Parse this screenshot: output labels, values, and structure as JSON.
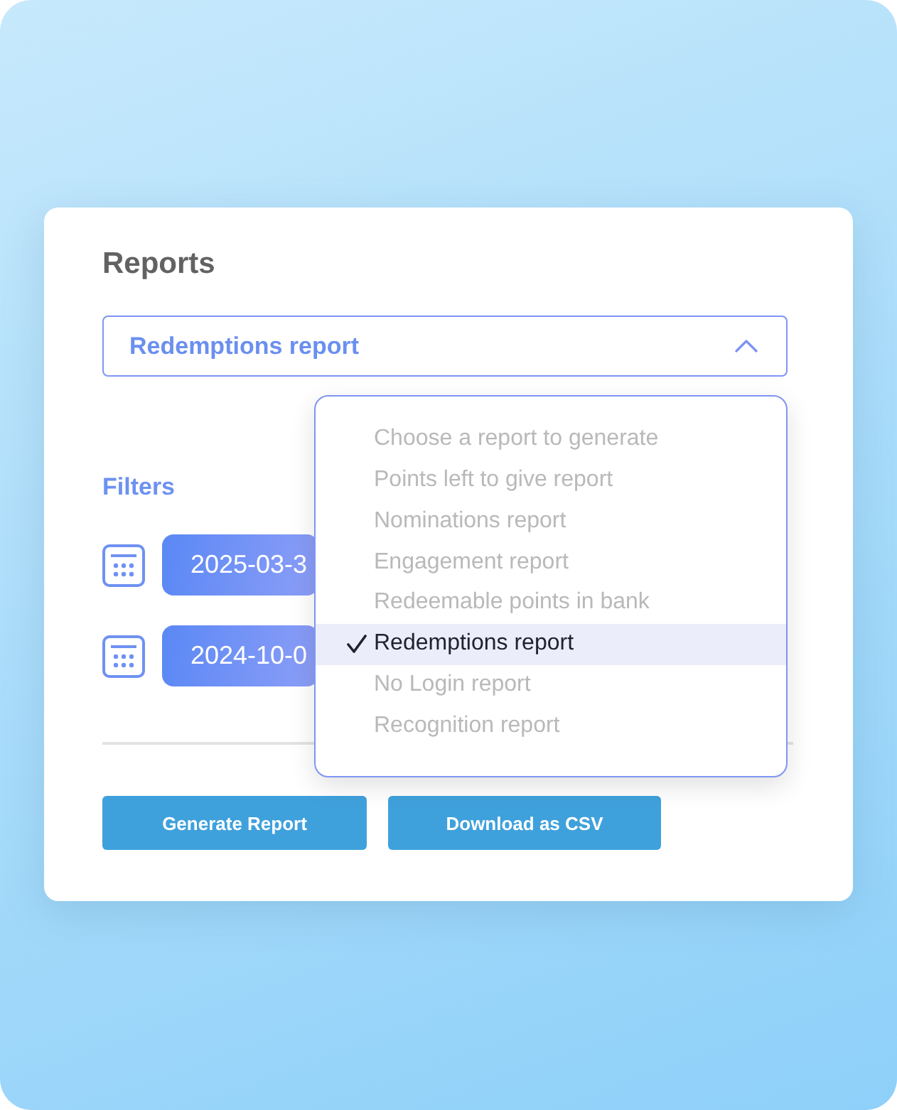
{
  "title": "Reports",
  "report_select": {
    "value": "Redemptions report",
    "expanded": true,
    "options": [
      {
        "label": "Choose a report to generate",
        "selected": false
      },
      {
        "label": "Points left to give report",
        "selected": false
      },
      {
        "label": "Nominations report",
        "selected": false
      },
      {
        "label": "Engagement report",
        "selected": false
      },
      {
        "label": "Redeemable points in bank",
        "selected": false
      },
      {
        "label": "Redemptions report",
        "selected": true
      },
      {
        "label": "No Login report",
        "selected": false
      },
      {
        "label": "Recognition report",
        "selected": false
      }
    ]
  },
  "filters": {
    "label": "Filters",
    "dates": [
      {
        "value": "2025-03-3"
      },
      {
        "value": "2024-10-0"
      }
    ]
  },
  "buttons": [
    {
      "label": "Generate Report"
    },
    {
      "label": "Download as CSV"
    }
  ]
}
